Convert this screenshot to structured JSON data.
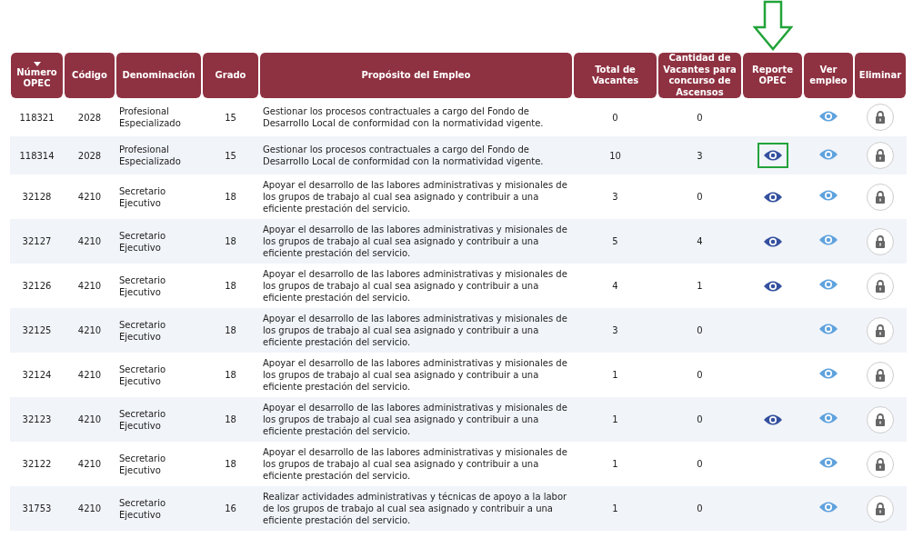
{
  "table": {
    "columns": [
      {
        "label": "Número OPEC",
        "sorted": true
      },
      {
        "label": "Código",
        "sorted": false
      },
      {
        "label": "Denominación",
        "sorted": false
      },
      {
        "label": "Grado",
        "sorted": false
      },
      {
        "label": "Propósito del Empleo",
        "sorted": false
      },
      {
        "label": "Total de Vacantes",
        "sorted": false
      },
      {
        "label": "Cantidad de Vacantes para concurso de Ascensos",
        "sorted": false
      },
      {
        "label": "Reporte OPEC",
        "sorted": false,
        "marked": true
      },
      {
        "label": "Ver empleo",
        "sorted": false
      },
      {
        "label": "Eliminar",
        "sorted": false
      }
    ],
    "rows": [
      {
        "opec": "118321",
        "codigo": "2028",
        "denominacion": "Profesional Especializado",
        "grado": "15",
        "proposito": "Gestionar los procesos contractuales a cargo del Fondo de Desarrollo Local de conformidad con la normatividad vigente.",
        "total": "0",
        "ascensos": "0",
        "reporte": false,
        "highlighted": false
      },
      {
        "opec": "118314",
        "codigo": "2028",
        "denominacion": "Profesional Especializado",
        "grado": "15",
        "proposito": "Gestionar los procesos contractuales a cargo del Fondo de Desarrollo Local de conformidad con la normatividad vigente.",
        "total": "10",
        "ascensos": "3",
        "reporte": true,
        "highlighted": true
      },
      {
        "opec": "32128",
        "codigo": "4210",
        "denominacion": "Secretario Ejecutivo",
        "grado": "18",
        "proposito": "Apoyar el desarrollo de las labores administrativas y misionales de los grupos de trabajo al cual sea asignado y contribuir a una eficiente prestación del servicio.",
        "total": "3",
        "ascensos": "0",
        "reporte": true,
        "highlighted": false
      },
      {
        "opec": "32127",
        "codigo": "4210",
        "denominacion": "Secretario Ejecutivo",
        "grado": "18",
        "proposito": "Apoyar el desarrollo de las labores administrativas y misionales de los grupos de trabajo al cual sea asignado y contribuir a una eficiente prestación del servicio.",
        "total": "5",
        "ascensos": "4",
        "reporte": true,
        "highlighted": false
      },
      {
        "opec": "32126",
        "codigo": "4210",
        "denominacion": "Secretario Ejecutivo",
        "grado": "18",
        "proposito": "Apoyar el desarrollo de las labores administrativas y misionales de los grupos de trabajo al cual sea asignado y contribuir a una eficiente prestación del servicio.",
        "total": "4",
        "ascensos": "1",
        "reporte": true,
        "highlighted": false
      },
      {
        "opec": "32125",
        "codigo": "4210",
        "denominacion": "Secretario Ejecutivo",
        "grado": "18",
        "proposito": "Apoyar el desarrollo de las labores administrativas y misionales de los grupos de trabajo al cual sea asignado y contribuir a una eficiente prestación del servicio.",
        "total": "3",
        "ascensos": "0",
        "reporte": false,
        "highlighted": false
      },
      {
        "opec": "32124",
        "codigo": "4210",
        "denominacion": "Secretario Ejecutivo",
        "grado": "18",
        "proposito": "Apoyar el desarrollo de las labores administrativas y misionales de los grupos de trabajo al cual sea asignado y contribuir a una eficiente prestación del servicio.",
        "total": "1",
        "ascensos": "0",
        "reporte": false,
        "highlighted": false
      },
      {
        "opec": "32123",
        "codigo": "4210",
        "denominacion": "Secretario Ejecutivo",
        "grado": "18",
        "proposito": "Apoyar el desarrollo de las labores administrativas y misionales de los grupos de trabajo al cual sea asignado y contribuir a una eficiente prestación del servicio.",
        "total": "1",
        "ascensos": "0",
        "reporte": true,
        "highlighted": false
      },
      {
        "opec": "32122",
        "codigo": "4210",
        "denominacion": "Secretario Ejecutivo",
        "grado": "18",
        "proposito": "Apoyar el desarrollo de las labores administrativas y misionales de los grupos de trabajo al cual sea asignado y contribuir a una eficiente prestación del servicio.",
        "total": "1",
        "ascensos": "0",
        "reporte": false,
        "highlighted": false
      },
      {
        "opec": "31753",
        "codigo": "4210",
        "denominacion": "Secretario Ejecutivo",
        "grado": "16",
        "proposito": "Realizar actividades administrativas y técnicas de apoyo a la labor de los grupos de trabajo al cual sea asignado y contribuir a una eficiente prestación del servicio.",
        "total": "1",
        "ascensos": "0",
        "reporte": false,
        "highlighted": false
      }
    ]
  }
}
